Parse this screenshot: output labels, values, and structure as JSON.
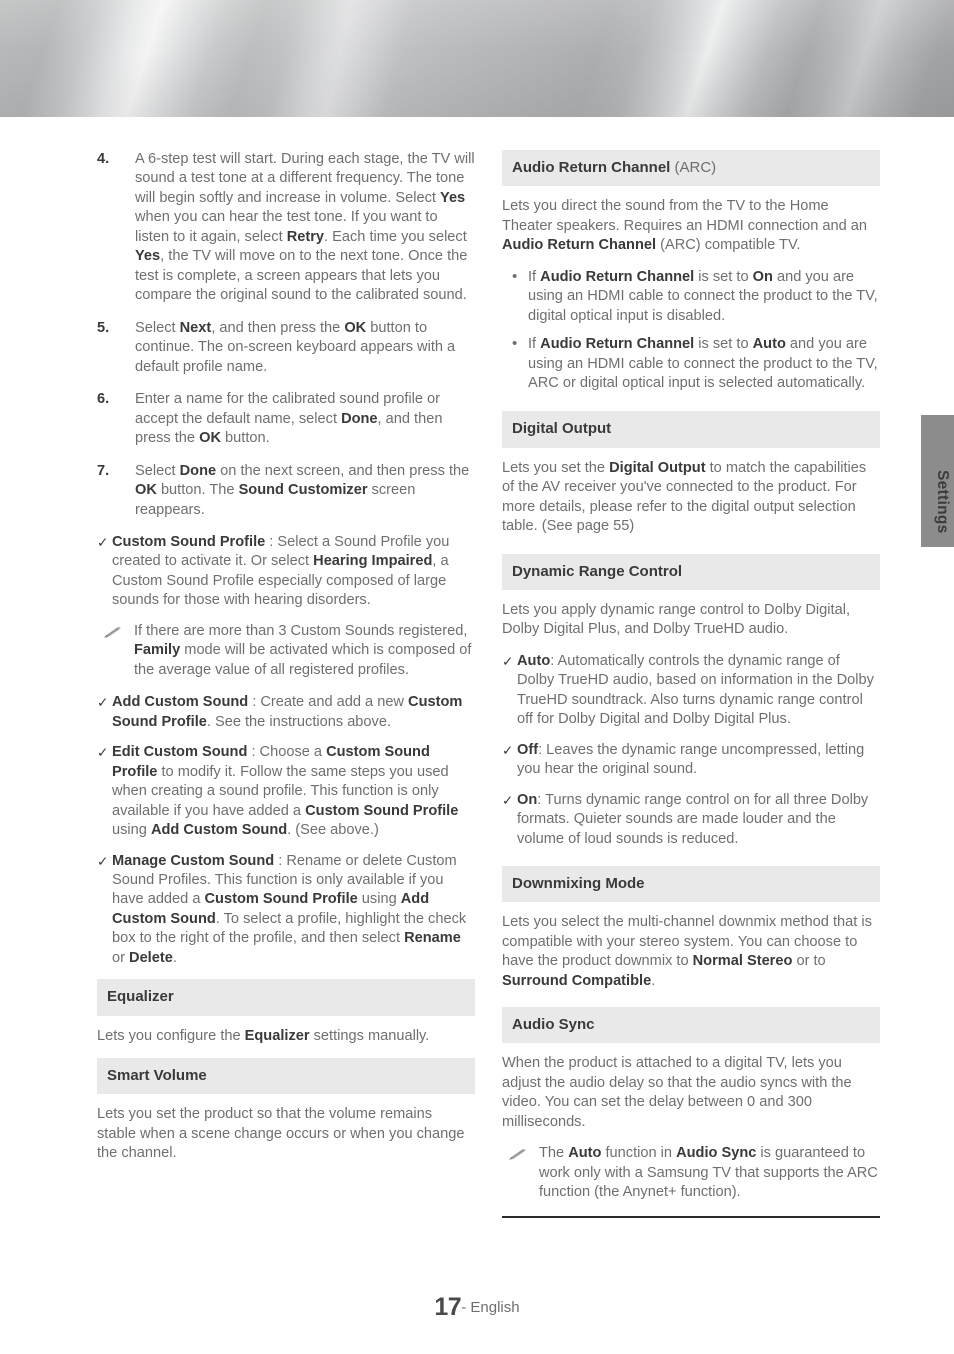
{
  "document": {
    "page_number": "17",
    "footer_language": "- English",
    "side_tab_label": "Settings"
  },
  "left_column": {
    "numbered_steps": [
      {
        "number": "4.",
        "html": "A 6-step test will start. During each stage, the TV will sound a test tone at a different frequency. The tone will begin softly and increase in volume. Select <b>Yes</b> when you can hear the test tone. If you want to listen to it again, select <b>Retry</b>. Each time you select <b>Yes</b>, the TV will move on to the next tone. Once the test is complete, a screen appears that lets you compare the original sound to the calibrated sound."
      },
      {
        "number": "5.",
        "html": "Select <b>Next</b>, and then press the <b>OK</b> button to continue. The on-screen keyboard appears with a default profile name."
      },
      {
        "number": "6.",
        "html": "Enter a name for the calibrated sound profile or accept the default name, select <b>Done</b>, and then press the <b>OK</b> button."
      },
      {
        "number": "7.",
        "html": "Select <b>Done</b> on the next screen, and then press the <b>OK</b> button. The <b>Sound Customizer</b> screen reappears."
      }
    ],
    "check_item_1": {
      "marker": "✓",
      "html": "<b>Custom Sound Profile</b> : Select a Sound Profile you created to activate it. Or select <b>Hearing Impaired</b>, a Custom Sound Profile especially composed of large sounds for those with hearing disorders."
    },
    "note_1": {
      "html": "If there are more than 3 Custom Sounds registered, <b>Family</b> mode will be activated which is composed of the average value of all registered profiles."
    },
    "check_item_2": {
      "marker": "✓",
      "html": "<b>Add Custom Sound</b> : Create and add a new <b>Custom Sound Profile</b>. See the instructions above."
    },
    "check_item_3": {
      "marker": "✓",
      "html": "<b>Edit Custom Sound</b> : Choose a <b>Custom Sound Profile</b> to modify it. Follow the same steps you used when creating a sound profile. This function is only available if you have added a <b>Custom Sound Profile</b> using <b>Add Custom Sound</b>. (See above.)"
    },
    "check_item_4": {
      "marker": "✓",
      "html": "<b>Manage Custom Sound</b> : Rename or delete Custom Sound Profiles. This function is only available if you have added a <b>Custom Sound Profile</b> using <b>Add Custom Sound</b>. To select a profile, highlight the check box to the right of the profile, and then select <b>Rename</b> or <b>Delete</b>."
    },
    "section_equalizer": {
      "title": "Equalizer",
      "body_html": "Lets you configure the <b>Equalizer</b> settings manually."
    },
    "section_smart_volume": {
      "title": "Smart Volume",
      "body_html": "Lets you set the product so that the volume remains stable when a scene change occurs or when you change the channel."
    }
  },
  "right_column": {
    "section_arc": {
      "title": "Audio Return Channel",
      "title_suffix": " (ARC)",
      "body_html": "Lets you direct the sound from the TV to the Home Theater speakers. Requires an HDMI connection and an <b>Audio Return Channel</b> (ARC) compatible TV.",
      "bullets": [
        {
          "marker": "•",
          "html": "If <b>Audio Return Channel</b> is set to <b>On</b> and you are using an HDMI cable to connect the product to the TV, digital optical input is disabled."
        },
        {
          "marker": "•",
          "html": "If <b>Audio Return Channel</b> is set to <b>Auto</b> and you are using an HDMI cable to connect the product to the TV, ARC or digital optical input is selected automatically."
        }
      ]
    },
    "section_digital_output": {
      "title": "Digital Output",
      "body_html": "Lets you set the <b>Digital Output</b> to match the capabilities of the AV receiver you've connected to the product. For more details, please refer to the digital output selection table. (See page 55)"
    },
    "section_drc": {
      "title": "Dynamic Range Control",
      "body_html": "Lets you apply dynamic range control to Dolby Digital, Dolby Digital Plus, and Dolby TrueHD audio.",
      "options": [
        {
          "marker": "✓",
          "html": "<b>Auto</b>: Automatically controls the dynamic range of Dolby TrueHD audio, based on information in the Dolby TrueHD soundtrack. Also turns dynamic range control off for Dolby Digital and Dolby Digital Plus."
        },
        {
          "marker": "✓",
          "html": "<b>Off</b>: Leaves the dynamic range uncompressed, letting you hear the original sound."
        },
        {
          "marker": "✓",
          "html": "<b>On</b>: Turns dynamic range control on for all three Dolby formats. Quieter sounds are made louder and the volume of loud sounds is reduced."
        }
      ]
    },
    "section_downmixing": {
      "title": "Downmixing Mode",
      "body_html": "Lets you select the multi-channel downmix method that is compatible with your stereo system. You can choose to have the product downmix to <b>Normal Stereo</b> or to <b>Surround Compatible</b>."
    },
    "section_audio_sync": {
      "title": "Audio Sync",
      "body_html": "When the product is attached to a digital TV, lets you adjust the audio delay so that the audio syncs with the video. You can set the delay between 0 and 300 milliseconds.",
      "note_html": "The <b>Auto</b> function in <b>Audio Sync</b> is guaranteed to work only with a Samsung TV that supports the ARC function (the Anynet+ function)."
    }
  },
  "colors": {
    "section_header_bg": "#e9e9e9",
    "body_text": "#6f6f6f",
    "emphasis_text": "#3a3a3a",
    "side_tab_bg": "#8c8c8c",
    "rule": "#2b2b2b"
  }
}
